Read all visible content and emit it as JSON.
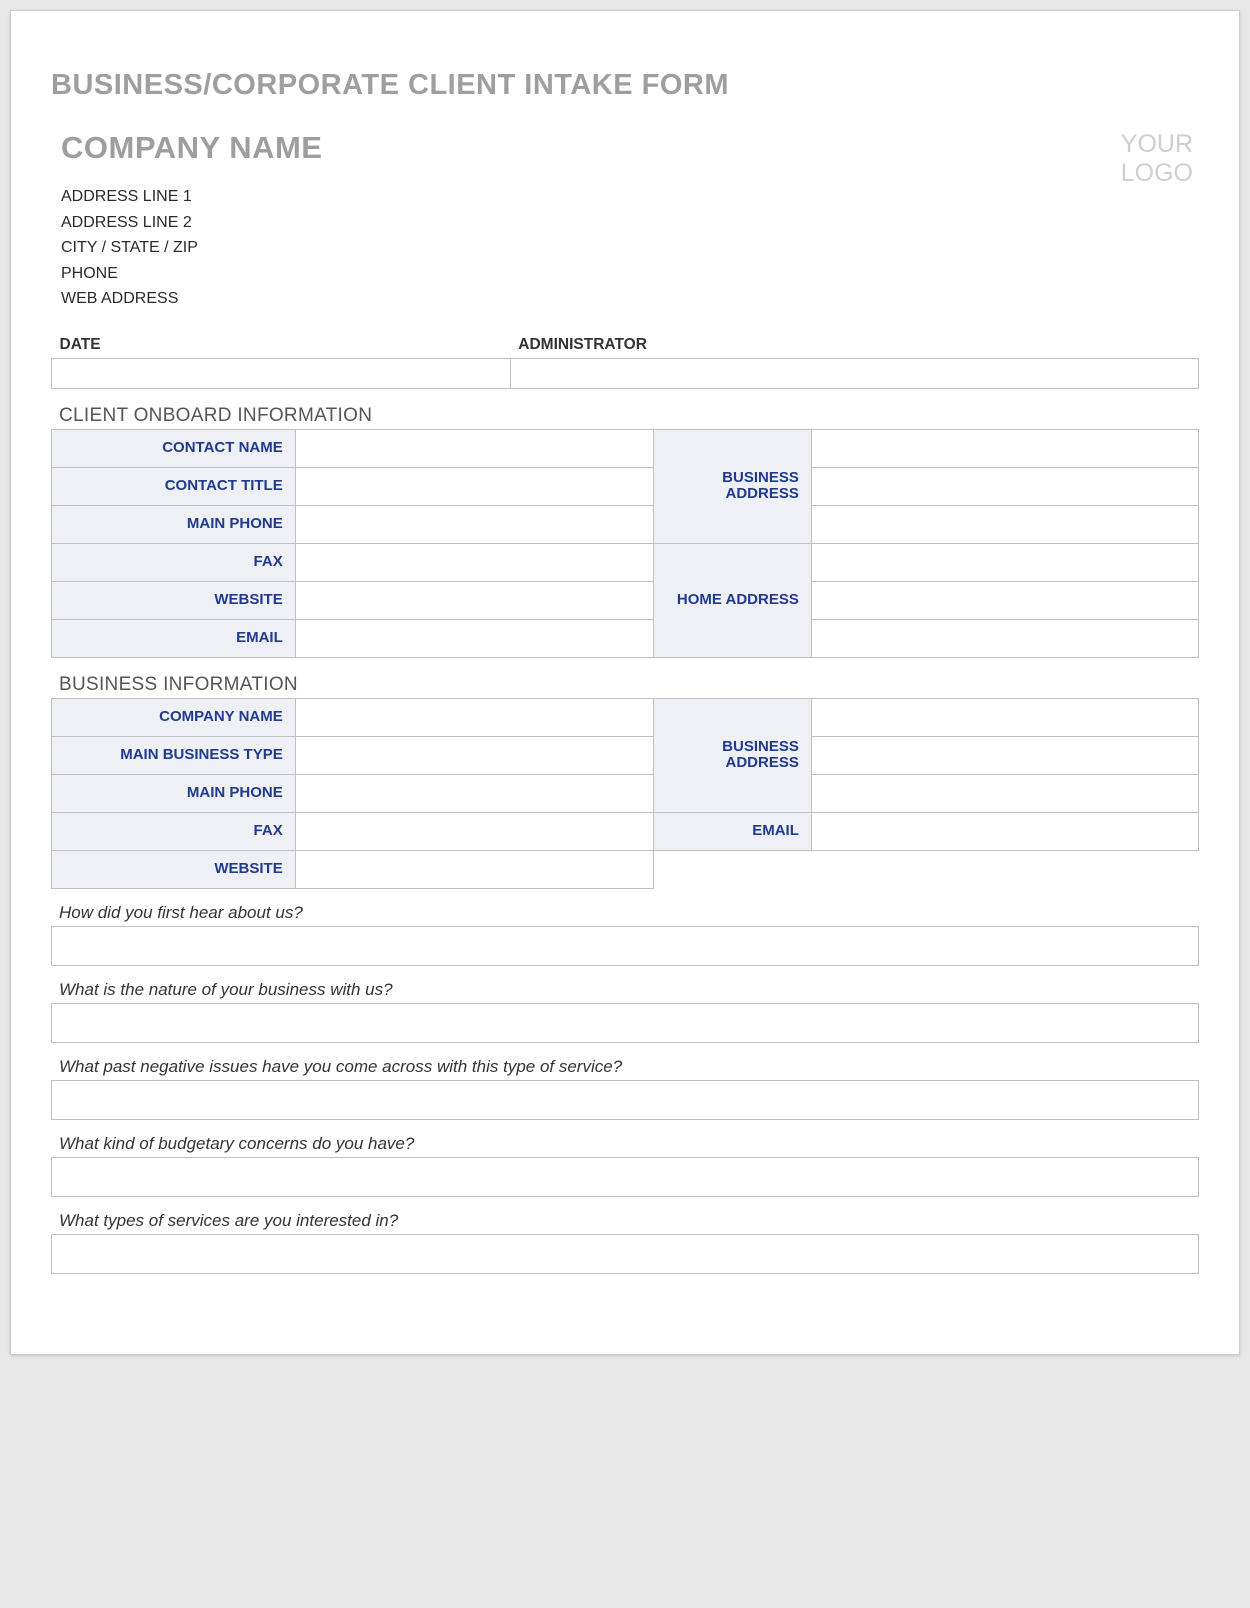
{
  "header": {
    "main_title": "BUSINESS/CORPORATE CLIENT INTAKE FORM",
    "company_name": "COMPANY NAME",
    "logo_line1": "YOUR",
    "logo_line2": "LOGO",
    "address_line1": "ADDRESS LINE 1",
    "address_line2": "ADDRESS LINE 2",
    "city_state_zip": "CITY / STATE / ZIP",
    "phone": "PHONE",
    "web_address": "WEB ADDRESS"
  },
  "date_admin": {
    "date_label": "DATE",
    "date_value": "",
    "admin_label": "ADMINISTRATOR",
    "admin_value": ""
  },
  "client_onboard": {
    "heading": "CLIENT ONBOARD INFORMATION",
    "contact_name_label": "CONTACT NAME",
    "contact_name_value": "",
    "contact_title_label": "CONTACT TITLE",
    "contact_title_value": "",
    "main_phone_label": "MAIN PHONE",
    "main_phone_value": "",
    "fax_label": "FAX",
    "fax_value": "",
    "website_label": "WEBSITE",
    "website_value": "",
    "email_label": "EMAIL",
    "email_value": "",
    "business_address_label": "BUSINESS ADDRESS",
    "business_address_line1": "",
    "business_address_line2": "",
    "business_address_line3": "",
    "home_address_label": "HOME ADDRESS",
    "home_address_line1": "",
    "home_address_line2": "",
    "home_address_line3": ""
  },
  "business_info": {
    "heading": "BUSINESS INFORMATION",
    "company_name_label": "COMPANY NAME",
    "company_name_value": "",
    "main_business_type_label": "MAIN BUSINESS TYPE",
    "main_business_type_value": "",
    "main_phone_label": "MAIN PHONE",
    "main_phone_value": "",
    "fax_label": "FAX",
    "fax_value": "",
    "website_label": "WEBSITE",
    "website_value": "",
    "business_address_label": "BUSINESS ADDRESS",
    "business_address_line1": "",
    "business_address_line2": "",
    "business_address_line3": "",
    "email_label": "EMAIL",
    "email_value": ""
  },
  "questions": {
    "q1": "How did you first hear about us?",
    "a1": "",
    "q2": "What is the nature of your business with us?",
    "a2": "",
    "q3": "What past negative issues have you come across with this type of service?",
    "a3": "",
    "q4": "What kind of budgetary concerns do you have?",
    "a4": "",
    "q5": "What types of services are you interested in?",
    "a5": ""
  }
}
